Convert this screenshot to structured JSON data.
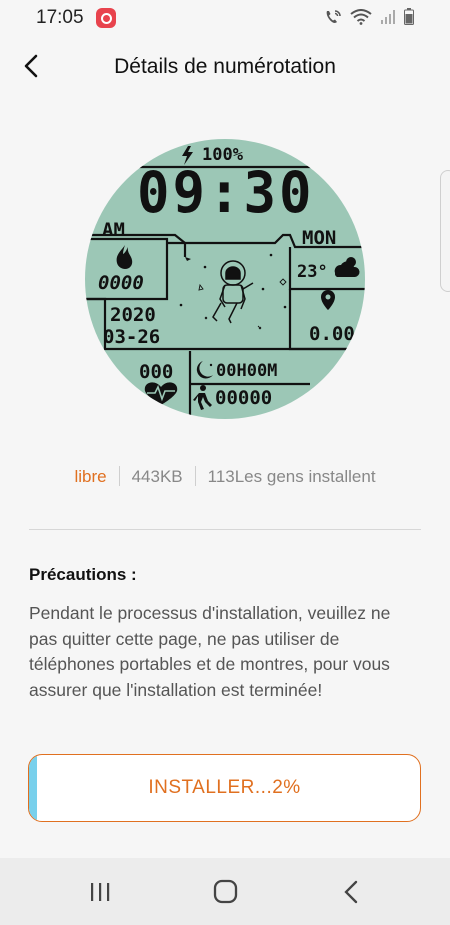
{
  "status_bar": {
    "time": "17:05",
    "icons": [
      "notification-app-icon",
      "wifi-calling-icon",
      "wifi-icon",
      "signal-icon",
      "battery-icon"
    ]
  },
  "header": {
    "title": "Détails de numérotation",
    "back_icon": "chevron-left-icon"
  },
  "watch_face": {
    "battery": "100%",
    "time": "09:30",
    "ampm": "AM",
    "day": "MON",
    "calories": "0000",
    "temperature": "23°",
    "date_year": "2020",
    "date_month_day": "03-26",
    "distance": "0.00",
    "heart_rate": "000",
    "sleep": "00H00M",
    "steps": "00000",
    "colors": {
      "face": "#9cc7b6",
      "lines": "#111111"
    }
  },
  "app_info": {
    "price": "libre",
    "size": "443KB",
    "installs": "113Les gens installent"
  },
  "precautions": {
    "title": "Précautions :",
    "text": "Pendant le processus d'installation, veuillez ne pas quitter cette page, ne pas utiliser de téléphones portables et de montres, pour vous assurer que l'installation est terminée!"
  },
  "install_button": {
    "label": "INSTALLER...2%",
    "progress": 0.02,
    "accent": "#e07020",
    "progress_color": "#78d0ec"
  },
  "nav_bar": {
    "buttons": [
      "recents-icon",
      "home-icon",
      "back-icon"
    ]
  }
}
